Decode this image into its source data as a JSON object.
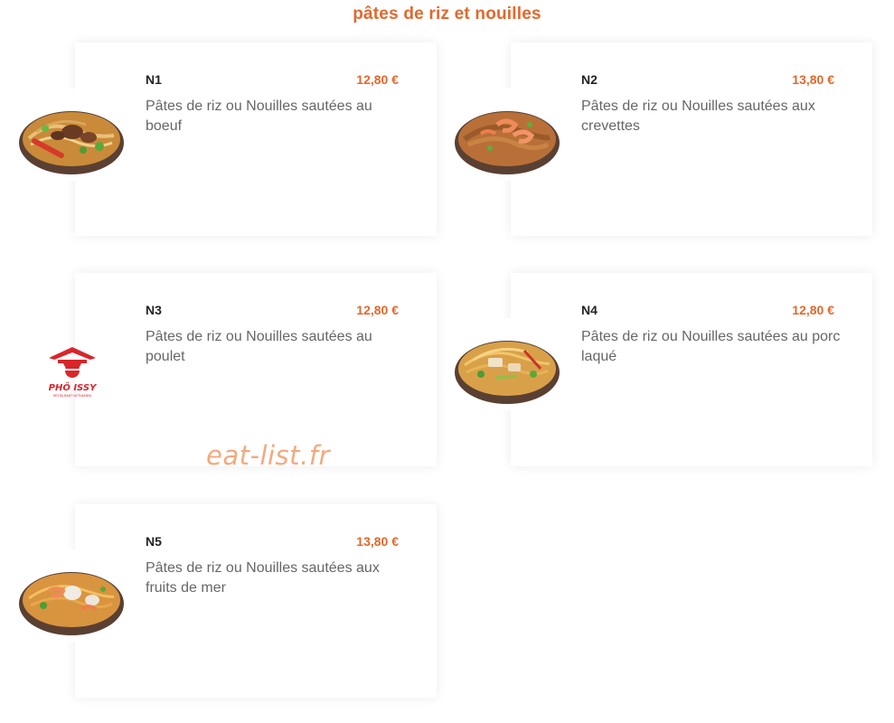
{
  "section": {
    "title": "pâtes de riz et nouilles"
  },
  "items": [
    {
      "code": "N1",
      "price": "12,80 €",
      "description": "Pâtes de riz ou Nouilles sautées au boeuf",
      "image_icon": "beef-noodles-dish-icon"
    },
    {
      "code": "N2",
      "price": "13,80 €",
      "description": "Pâtes de riz ou Nouilles sautées aux crevettes",
      "image_icon": "shrimp-noodles-dish-icon"
    },
    {
      "code": "N3",
      "price": "12,80 €",
      "description": "Pâtes de riz ou Nouilles sautées au poulet",
      "image_icon": "pho-issy-logo-icon"
    },
    {
      "code": "N4",
      "price": "12,80 €",
      "description": "Pâtes de riz ou Nouilles sautées au porc laqué",
      "image_icon": "pork-noodles-dish-icon"
    },
    {
      "code": "N5",
      "price": "13,80 €",
      "description": "Pâtes de riz ou Nouilles sautées aux fruits de mer",
      "image_icon": "seafood-noodles-dish-icon"
    }
  ],
  "logo": {
    "name": "PHÔ ISSY",
    "tagline": "RESTAURANT VIETNAMIEN"
  },
  "watermark": "eat-list.fr",
  "colors": {
    "accent": "#e2682d",
    "watermark": "#f4a97e"
  }
}
